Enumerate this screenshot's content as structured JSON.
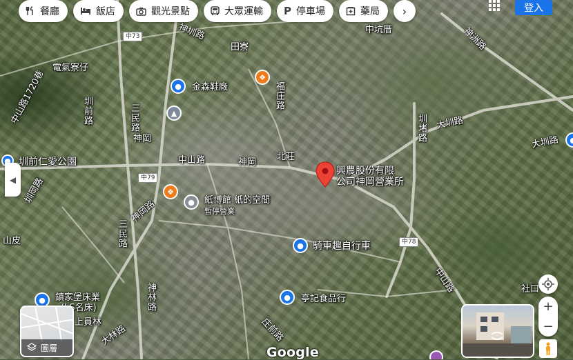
{
  "chips": [
    {
      "icon": "utensils-icon",
      "label": "餐廳"
    },
    {
      "icon": "bed-icon",
      "label": "飯店"
    },
    {
      "icon": "camera-icon",
      "label": "觀光景點"
    },
    {
      "icon": "bus-icon",
      "label": "大眾運輸"
    },
    {
      "icon": "parking-icon",
      "label": "停車場"
    },
    {
      "icon": "pharmacy-icon",
      "label": "藥局"
    }
  ],
  "login_label": "登入",
  "layers_label": "圖層",
  "google_label": "Google",
  "place_pin": {
    "name_line1": "興農股份有限",
    "name_line2": "公司神岡營業所"
  },
  "poi": {
    "shoe_factory": "金森鞋廠",
    "paper_museum": "紙博館 紙的空間",
    "paper_museum_status": "暫停營業",
    "bike_shop": "騎車趣自行車",
    "food_shop": "亭記食品行",
    "bed_shop_line1": "鎮家堡床業",
    "bed_shop_line2": "(LS名床)",
    "park": "圳前仁愛公園"
  },
  "areas": {
    "zhongkeng": "中坑厝",
    "tianliao": "田寮",
    "dianqi": "電氣寮仔",
    "shengang": "神岡",
    "shengang2": "神岡",
    "beizhuang": "北莊",
    "shanpi": "山皮",
    "shangyuanlin": "上員林",
    "shekou": "社口"
  },
  "roads": {
    "shenzhen_top": "神圳路",
    "zhongshan_1720": "中山路1720巷",
    "shengang_road_left": "圳前路",
    "sanmin": "三民路",
    "zhongshan_mid": "中山路",
    "shenzhou": "神洲路",
    "fuzhuang": "福庄路",
    "dazhen": "大圳路",
    "dazhen_right": "大圳路",
    "shenzhen_right": "圳堵路",
    "shengang_rd": "神岡路",
    "sanmin_south": "三民路",
    "shenlin": "神林路",
    "dalin": "大林路",
    "zhuangqian": "庄前路",
    "zhongshan_lower": "中山路",
    "zhanggang": "圳岡路"
  },
  "shields": {
    "s1": "中73",
    "s2": "中79",
    "s3": "中78"
  }
}
